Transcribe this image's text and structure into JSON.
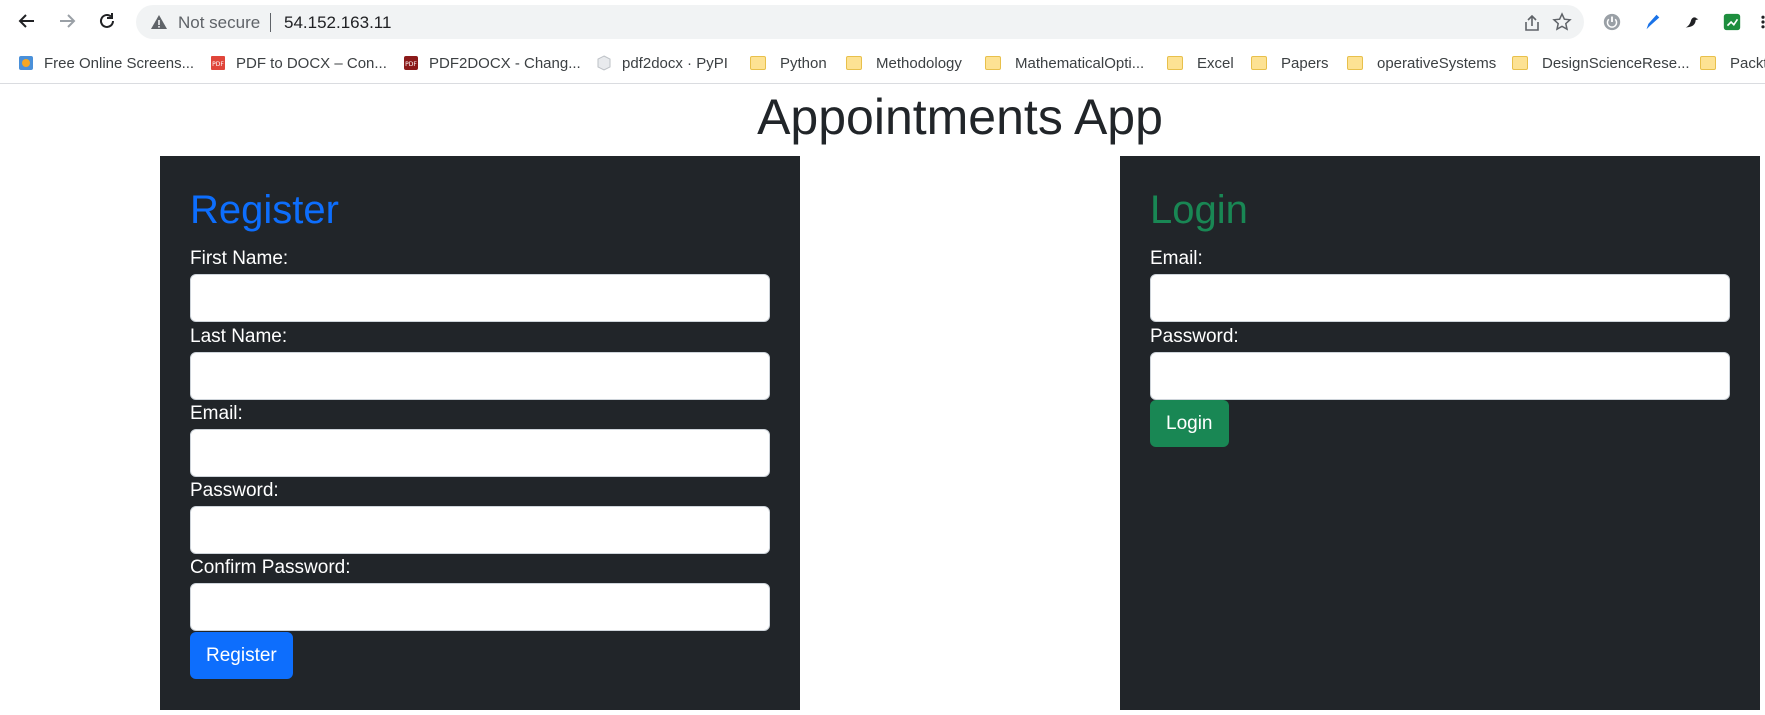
{
  "browser": {
    "security_label": "Not secure",
    "url": "54.152.163.11"
  },
  "bookmarks": [
    {
      "label": "Free Online Screens...",
      "icon": "screenshot-icon"
    },
    {
      "label": "PDF to DOCX – Con...",
      "icon": "pdf-icon"
    },
    {
      "label": "PDF2DOCX - Chang...",
      "icon": "pdf-icon"
    },
    {
      "label": "pdf2docx · PyPI",
      "icon": "package-icon"
    },
    {
      "label": "Python",
      "icon": "folder-icon"
    },
    {
      "label": "Methodology",
      "icon": "folder-icon"
    },
    {
      "label": "MathematicalOpti...",
      "icon": "folder-icon"
    },
    {
      "label": "Excel",
      "icon": "folder-icon"
    },
    {
      "label": "Papers",
      "icon": "folder-icon"
    },
    {
      "label": "operativeSystems",
      "icon": "folder-icon"
    },
    {
      "label": "DesignScienceRese...",
      "icon": "folder-icon"
    },
    {
      "label": "Packt",
      "icon": "folder-icon"
    }
  ],
  "page": {
    "title": "Appointments App"
  },
  "register": {
    "heading": "Register",
    "first_name_label": "First Name:",
    "last_name_label": "Last Name:",
    "email_label": "Email:",
    "password_label": "Password:",
    "confirm_password_label": "Confirm Password:",
    "button_label": "Register"
  },
  "login": {
    "heading": "Login",
    "email_label": "Email:",
    "password_label": "Password:",
    "button_label": "Login"
  },
  "colors": {
    "panel_bg": "#212529",
    "register_accent": "#0d6efd",
    "login_accent": "#198754"
  }
}
